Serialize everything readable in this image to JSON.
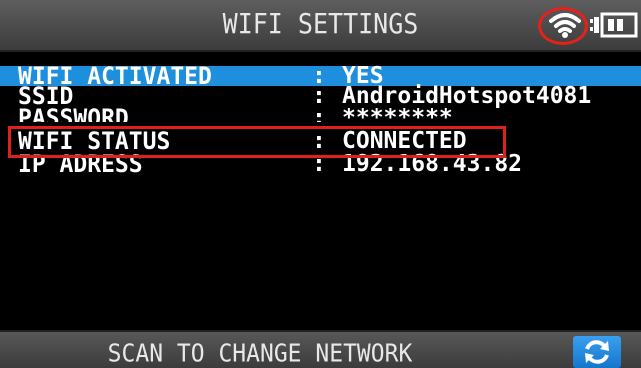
{
  "header": {
    "title": "WIFI SETTINGS",
    "wifi_icon": "wifi-signal-icon",
    "battery_icon": "battery-charging-icon"
  },
  "settings": [
    {
      "label": "WIFI ACTIVATED",
      "sep": ":",
      "value": "YES",
      "selected": true
    },
    {
      "label": "SSID",
      "sep": ":",
      "value": "AndroidHotspot4081"
    },
    {
      "label": "PASSWORD",
      "sep": ":",
      "value": "********"
    },
    {
      "label": "WIFI STATUS",
      "sep": ":",
      "value": "CONNECTED"
    },
    {
      "label": "IP ADRESS",
      "sep": ":",
      "value": "192.168.43.82"
    }
  ],
  "footer": {
    "action_label": "SCAN TO CHANGE NETWORK",
    "refresh_icon": "refresh-icon"
  },
  "colors": {
    "selection": "#1d8fdd",
    "highlight_annotation": "#e0201c",
    "header_bg": "#4a4a4a",
    "refresh_button": "#1f86dc"
  }
}
